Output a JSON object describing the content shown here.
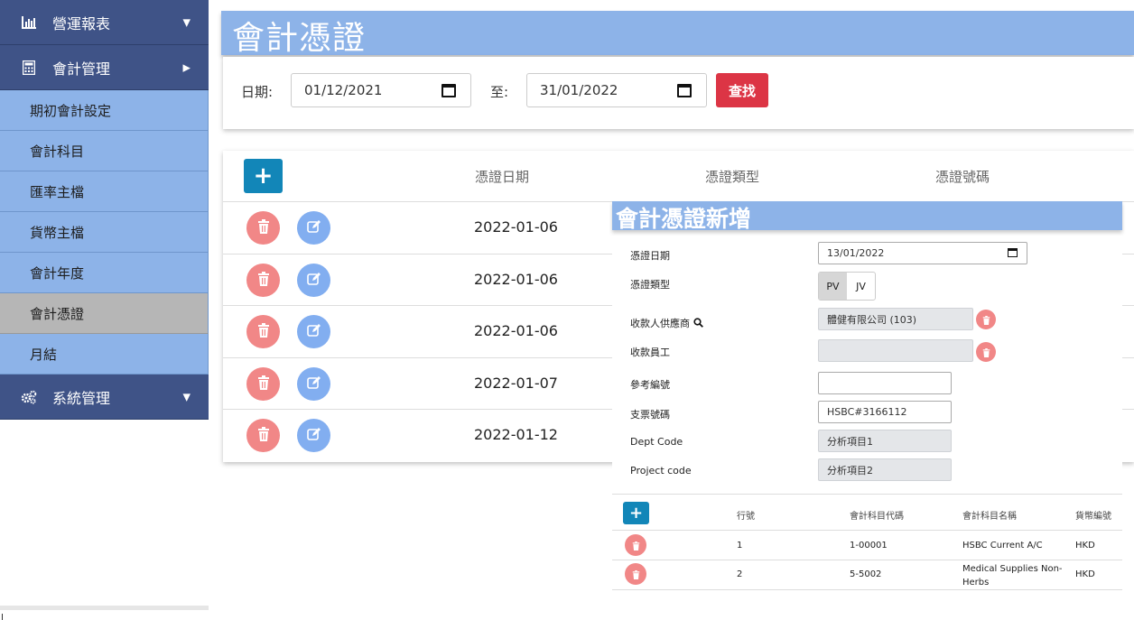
{
  "sidebar": {
    "reports": "營運報表",
    "accounting": "會計管理",
    "items": [
      "期初會計設定",
      "會計科目",
      "匯率主檔",
      "貨幣主檔",
      "會計年度",
      "會計憑證",
      "月結"
    ],
    "system": "系統管理"
  },
  "page": {
    "title": "會計憑證"
  },
  "filter": {
    "date_label": "日期:",
    "from": "01/12/2021",
    "to_label": "至:",
    "to": "31/01/2022",
    "search": "查找"
  },
  "table": {
    "headers": [
      "憑證日期",
      "憑證類型",
      "憑證號碼"
    ],
    "rows": [
      "2022-01-06",
      "2022-01-06",
      "2022-01-06",
      "2022-01-07",
      "2022-01-12"
    ]
  },
  "dialog": {
    "title": "會計憑證新增",
    "voucher_date_label": "憑證日期",
    "voucher_date": "13/01/2022",
    "voucher_type_label": "憑證類型",
    "type_pv": "PV",
    "type_jv": "JV",
    "payee_supplier_label": "收款人供應商",
    "payee_supplier": "體健有限公司 (103)",
    "payee_staff_label": "收款員工",
    "payee_staff": "",
    "ref_label": "參考編號",
    "ref": "",
    "cheque_label": "支票號碼",
    "cheque": "HSBC#3166112",
    "dept_label": "Dept Code",
    "dept": "分析項目1",
    "project_label": "Project code",
    "project": "分析項目2",
    "lines": {
      "headers": [
        "行號",
        "會計科目代碼",
        "會計科目名稱",
        "貨幣編號"
      ],
      "rows": [
        {
          "no": "1",
          "code": "1-00001",
          "name": "HSBC Current A/C",
          "cur": "HKD"
        },
        {
          "no": "2",
          "code": "5-5002",
          "name": "Medical Supplies Non-Herbs",
          "cur": "HKD"
        }
      ]
    }
  }
}
